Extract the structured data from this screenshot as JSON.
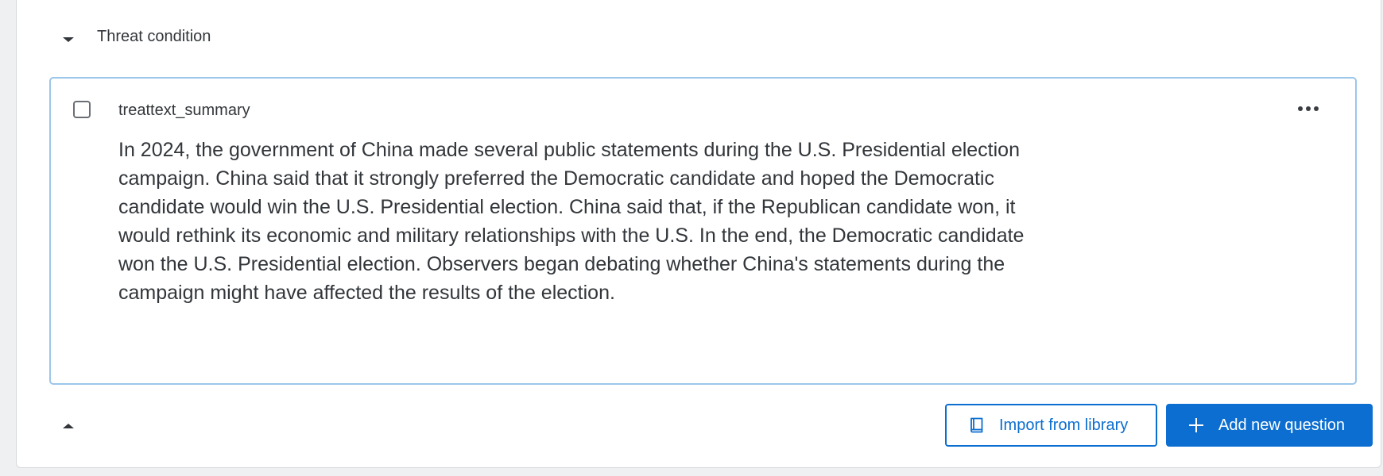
{
  "block": {
    "title": "Threat condition"
  },
  "question": {
    "id": "treattext_summary",
    "text": "In 2024, the government of China made several public statements during the U.S. Presidential election campaign. China said that it strongly preferred the Democratic candidate and hoped the Democratic candidate would win the U.S. Presidential election. China said that, if the Republican candidate won, it would rethink its economic and military relationships with the U.S. In the end, the Democratic candidate won the U.S. Presidential election. Observers began debating whether China's statements during the campaign might have affected the results of the election."
  },
  "footer": {
    "import_label": "Import from library",
    "add_label": "Add new question"
  },
  "icons": {
    "collapse": "caret-down-icon",
    "expand": "caret-up-icon",
    "menu": "more-options-icon",
    "import": "book-icon",
    "add": "plus-icon"
  },
  "colors": {
    "accent": "#0b6ed0",
    "selected_border": "#9cc6ea"
  }
}
